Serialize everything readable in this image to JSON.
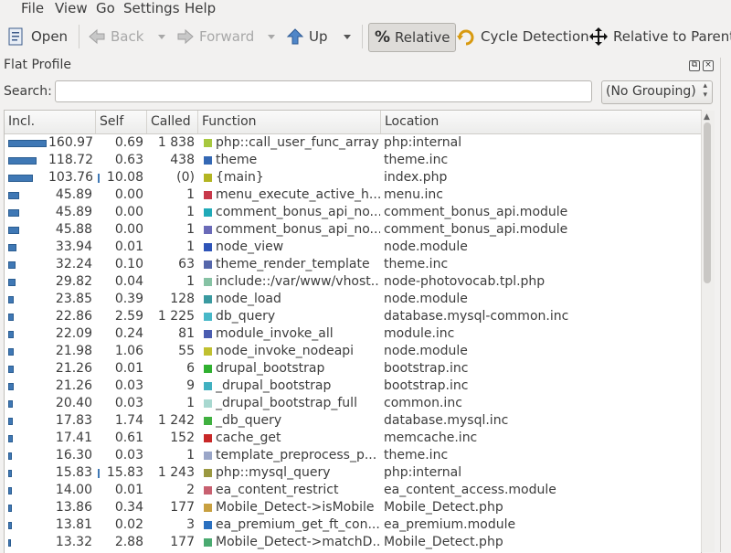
{
  "menu": [
    "File",
    "View",
    "Go",
    "Settings",
    "Help"
  ],
  "toolbar": {
    "open": "Open",
    "back": "Back",
    "forward": "Forward",
    "up": "Up",
    "relative": "Relative",
    "cycle": "Cycle Detection",
    "relative_parent": "Relative to Parent"
  },
  "panel": {
    "title": "Flat Profile"
  },
  "search": {
    "label": "Search:",
    "value": "",
    "grouping": "(No Grouping)"
  },
  "table": {
    "headers": [
      "Incl.",
      "Self",
      "Called",
      "Function",
      "Location"
    ],
    "rows": [
      {
        "incl": "160.97",
        "self": "0.69",
        "called": "1 838",
        "func": "php::call_user_func_array",
        "loc": "php:internal",
        "bar": 1.0,
        "selfbar": false,
        "color": "#a7c83f"
      },
      {
        "incl": "118.72",
        "self": "0.63",
        "called": "438",
        "func": "theme",
        "loc": "theme.inc",
        "bar": 0.7375,
        "selfbar": false,
        "color": "#3468b4"
      },
      {
        "incl": "103.76",
        "self": "10.08",
        "called": "(0)",
        "func": "{main}",
        "loc": "index.php",
        "bar": 0.6446,
        "selfbar": true,
        "color": "#b3b522"
      },
      {
        "incl": "45.89",
        "self": "0.00",
        "called": "1",
        "func": "menu_execute_active_h...",
        "loc": "menu.inc",
        "bar": 0.2851,
        "selfbar": false,
        "color": "#c8384a"
      },
      {
        "incl": "45.89",
        "self": "0.00",
        "called": "1",
        "func": "comment_bonus_api_no...",
        "loc": "comment_bonus_api.module",
        "bar": 0.2851,
        "selfbar": false,
        "color": "#20aab8"
      },
      {
        "incl": "45.88",
        "self": "0.00",
        "called": "1",
        "func": "comment_bonus_api_no...",
        "loc": "comment_bonus_api.module",
        "bar": 0.285,
        "selfbar": false,
        "color": "#6a6ab8"
      },
      {
        "incl": "33.94",
        "self": "0.01",
        "called": "1",
        "func": "node_view",
        "loc": "node.module",
        "bar": 0.2108,
        "selfbar": false,
        "color": "#2e54b8"
      },
      {
        "incl": "32.24",
        "self": "0.10",
        "called": "63",
        "func": "theme_render_template",
        "loc": "theme.inc",
        "bar": 0.2003,
        "selfbar": false,
        "color": "#5566aa"
      },
      {
        "incl": "29.82",
        "self": "0.04",
        "called": "1",
        "func": "include::/var/www/vhost...",
        "loc": "node-photovocab.tpl.php",
        "bar": 0.1853,
        "selfbar": false,
        "color": "#86c2a4"
      },
      {
        "incl": "23.85",
        "self": "0.39",
        "called": "128",
        "func": "node_load",
        "loc": "node.module",
        "bar": 0.1482,
        "selfbar": false,
        "color": "#3a9aa0"
      },
      {
        "incl": "22.86",
        "self": "2.59",
        "called": "1 225",
        "func": "db_query",
        "loc": "database.mysql-common.inc",
        "bar": 0.142,
        "selfbar": false,
        "color": "#48b8c8"
      },
      {
        "incl": "22.09",
        "self": "0.24",
        "called": "81",
        "func": "module_invoke_all",
        "loc": "module.inc",
        "bar": 0.1372,
        "selfbar": false,
        "color": "#4a5cb0"
      },
      {
        "incl": "21.98",
        "self": "1.06",
        "called": "55",
        "func": "node_invoke_nodeapi",
        "loc": "node.module",
        "bar": 0.1365,
        "selfbar": false,
        "color": "#c0c030"
      },
      {
        "incl": "21.26",
        "self": "0.01",
        "called": "6",
        "func": "drupal_bootstrap",
        "loc": "bootstrap.inc",
        "bar": 0.1321,
        "selfbar": false,
        "color": "#30b030"
      },
      {
        "incl": "21.26",
        "self": "0.03",
        "called": "9",
        "func": "_drupal_bootstrap",
        "loc": "bootstrap.inc",
        "bar": 0.1321,
        "selfbar": false,
        "color": "#40b0c0"
      },
      {
        "incl": "20.40",
        "self": "0.03",
        "called": "1",
        "func": "_drupal_bootstrap_full",
        "loc": "common.inc",
        "bar": 0.1267,
        "selfbar": false,
        "color": "#a8d8d0"
      },
      {
        "incl": "17.83",
        "self": "1.74",
        "called": "1 242",
        "func": "_db_query",
        "loc": "database.mysql.inc",
        "bar": 0.1108,
        "selfbar": false,
        "color": "#40b040"
      },
      {
        "incl": "17.41",
        "self": "0.61",
        "called": "152",
        "func": "cache_get",
        "loc": "memcache.inc",
        "bar": 0.1082,
        "selfbar": false,
        "color": "#c82828"
      },
      {
        "incl": "16.30",
        "self": "0.03",
        "called": "1",
        "func": "template_preprocess_p...",
        "loc": "theme.inc",
        "bar": 0.1013,
        "selfbar": false,
        "color": "#9aa6c8"
      },
      {
        "incl": "15.83",
        "self": "15.83",
        "called": "1 243",
        "func": "php::mysql_query",
        "loc": "php:internal",
        "bar": 0.0983,
        "selfbar": true,
        "color": "#9a9840"
      },
      {
        "incl": "14.00",
        "self": "0.01",
        "called": "2",
        "func": "ea_content_restrict",
        "loc": "ea_content_access.module",
        "bar": 0.087,
        "selfbar": false,
        "color": "#c86070"
      },
      {
        "incl": "13.86",
        "self": "0.34",
        "called": "177",
        "func": "Mobile_Detect->isMobile",
        "loc": "Mobile_Detect.php",
        "bar": 0.0861,
        "selfbar": false,
        "color": "#c8a040"
      },
      {
        "incl": "13.81",
        "self": "0.02",
        "called": "3",
        "func": "ea_premium_get_ft_con...",
        "loc": "ea_premium.module",
        "bar": 0.0858,
        "selfbar": false,
        "color": "#2a70c0"
      },
      {
        "incl": "13.32",
        "self": "2.88",
        "called": "177",
        "func": "Mobile_Detect->matchD...",
        "loc": "Mobile_Detect.php",
        "bar": 0.0827,
        "selfbar": false,
        "color": "#4aaa70"
      }
    ]
  }
}
